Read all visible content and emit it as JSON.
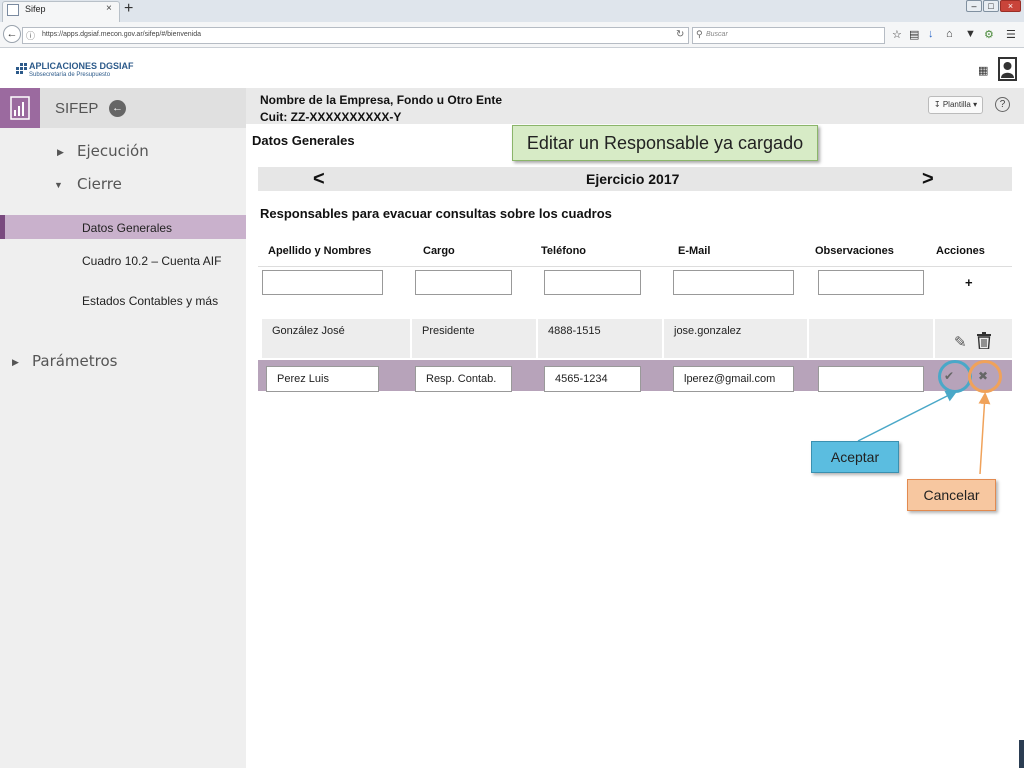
{
  "browser": {
    "tab_title": "Sifep",
    "tab_close": "×",
    "new_tab": "+",
    "url": "https://apps.dgsiaf.mecon.gov.ar/sifep/#/bienvenida",
    "search_placeholder": "Buscar",
    "window_controls": [
      "–",
      "□",
      "×"
    ]
  },
  "app": {
    "logo_title": "APLICACIONES DGSIAF",
    "logo_subtitle": "Subsecretaría de Presupuesto",
    "module_name": "SIFEP"
  },
  "sidebar": {
    "sections": [
      {
        "label": "Ejecución",
        "expanded": false
      },
      {
        "label": "Cierre",
        "expanded": true
      },
      {
        "label": "Parámetros",
        "expanded": false
      }
    ],
    "items": [
      {
        "label": "Datos Generales",
        "active": true
      },
      {
        "label": "Cuadro 10.2  – Cuenta AIF",
        "active": false
      },
      {
        "label": "Estados Contables y más",
        "active": false
      }
    ]
  },
  "header": {
    "company_name": "Nombre de la Empresa, Fondo u Otro Ente",
    "company_cuit": "Cuit: ZZ-XXXXXXXXXX-Y",
    "plantilla_label": "Plantilla",
    "help_glyph": "?"
  },
  "main": {
    "section_title": "Datos Generales",
    "year_prev": "<",
    "year_next": ">",
    "year_label": "Ejercicio 2017",
    "table_title": "Responsables para evacuar consultas sobre los cuadros",
    "columns": [
      "Apellido y Nombres",
      "Cargo",
      "Teléfono",
      "E-Mail",
      "Observaciones",
      "Acciones"
    ],
    "add_label": "+",
    "rows": [
      {
        "nombre": "González José",
        "cargo": "Presidente",
        "telefono": "4888-1515",
        "email": "jose.gonzalez",
        "observaciones": ""
      },
      {
        "nombre": "Perez Luis",
        "cargo": "Resp. Contab.",
        "telefono": "4565-1234",
        "email": "lperez@gmail.com",
        "observaciones": ""
      }
    ]
  },
  "callouts": {
    "editar": "Editar un Responsable ya cargado",
    "aceptar": "Aceptar",
    "cancelar": "Cancelar"
  },
  "colors": {
    "accent_purple": "#9b6a9f",
    "editing_row": "#b7a3ba",
    "callout_green": "#d7ebc6",
    "callout_blue": "#5bbde0",
    "callout_orange": "#f7c7a0"
  }
}
